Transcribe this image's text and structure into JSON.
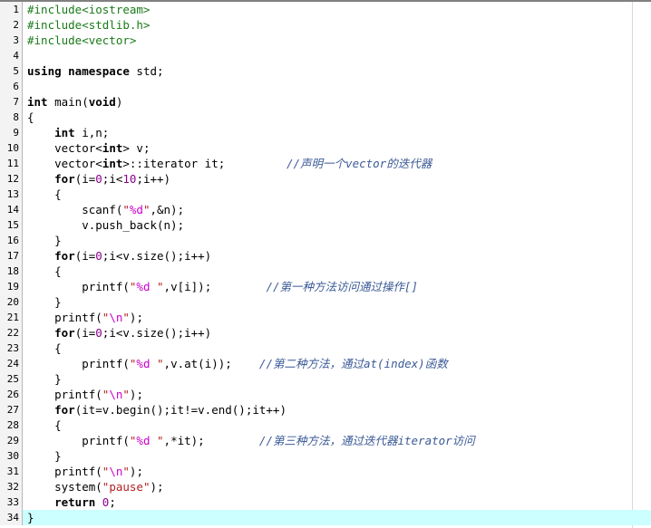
{
  "editor": {
    "name": "cpp-source-code-view",
    "language": "C++",
    "total_lines": 34,
    "highlighted_line": 34,
    "colors": {
      "background": "#ffffff",
      "gutter_background": "#f3f3f3",
      "gutter_separator": "#b8b8b8",
      "highlight_line": "#ccffff",
      "preprocessor": "#1a7a1a",
      "keyword": "#000000",
      "string": "#b22222",
      "escape": "#cc00cc",
      "number": "#8b008b",
      "comment": "#3b5a96",
      "margin_guide": "#d8d8d8"
    }
  },
  "lines": [
    {
      "number": "1",
      "tokens": [
        {
          "t": "#include<iostream>",
          "c": "tok-pre"
        }
      ]
    },
    {
      "number": "2",
      "tokens": [
        {
          "t": "#include<stdlib.h>",
          "c": "tok-pre"
        }
      ]
    },
    {
      "number": "3",
      "tokens": [
        {
          "t": "#include<vector>",
          "c": "tok-pre"
        }
      ]
    },
    {
      "number": "4",
      "tokens": []
    },
    {
      "number": "5",
      "tokens": [
        {
          "t": "using namespace",
          "c": "tok-kw"
        },
        {
          "t": " std;",
          "c": "tok-plain"
        }
      ]
    },
    {
      "number": "6",
      "tokens": []
    },
    {
      "number": "7",
      "tokens": [
        {
          "t": "int",
          "c": "tok-kw"
        },
        {
          "t": " main(",
          "c": "tok-plain"
        },
        {
          "t": "void",
          "c": "tok-kw"
        },
        {
          "t": ")",
          "c": "tok-plain"
        }
      ]
    },
    {
      "number": "8",
      "tokens": [
        {
          "t": "{",
          "c": "tok-plain"
        }
      ]
    },
    {
      "number": "9",
      "tokens": [
        {
          "t": "    ",
          "c": "tok-plain"
        },
        {
          "t": "int",
          "c": "tok-kw"
        },
        {
          "t": " i,n;",
          "c": "tok-plain"
        }
      ]
    },
    {
      "number": "10",
      "tokens": [
        {
          "t": "    vector<",
          "c": "tok-plain"
        },
        {
          "t": "int",
          "c": "tok-kw"
        },
        {
          "t": "> v;",
          "c": "tok-plain"
        }
      ]
    },
    {
      "number": "11",
      "tokens": [
        {
          "t": "    vector<",
          "c": "tok-plain"
        },
        {
          "t": "int",
          "c": "tok-kw"
        },
        {
          "t": ">::iterator it;",
          "c": "tok-plain"
        },
        {
          "t": "         ",
          "c": "tok-plain"
        },
        {
          "t": "//声明一个vector的迭代器",
          "c": "tok-cmt"
        }
      ]
    },
    {
      "number": "12",
      "tokens": [
        {
          "t": "    ",
          "c": "tok-plain"
        },
        {
          "t": "for",
          "c": "tok-kw"
        },
        {
          "t": "(i=",
          "c": "tok-plain"
        },
        {
          "t": "0",
          "c": "tok-num"
        },
        {
          "t": ";i<",
          "c": "tok-plain"
        },
        {
          "t": "10",
          "c": "tok-num"
        },
        {
          "t": ";i++)",
          "c": "tok-plain"
        }
      ]
    },
    {
      "number": "13",
      "tokens": [
        {
          "t": "    {",
          "c": "tok-plain"
        }
      ]
    },
    {
      "number": "14",
      "tokens": [
        {
          "t": "        scanf(",
          "c": "tok-plain"
        },
        {
          "t": "\"",
          "c": "tok-str"
        },
        {
          "t": "%d",
          "c": "tok-esc"
        },
        {
          "t": "\"",
          "c": "tok-str"
        },
        {
          "t": ",&n);",
          "c": "tok-plain"
        }
      ]
    },
    {
      "number": "15",
      "tokens": [
        {
          "t": "        v.push_back(n);",
          "c": "tok-plain"
        }
      ]
    },
    {
      "number": "16",
      "tokens": [
        {
          "t": "    }",
          "c": "tok-plain"
        }
      ]
    },
    {
      "number": "17",
      "tokens": [
        {
          "t": "    ",
          "c": "tok-plain"
        },
        {
          "t": "for",
          "c": "tok-kw"
        },
        {
          "t": "(i=",
          "c": "tok-plain"
        },
        {
          "t": "0",
          "c": "tok-num"
        },
        {
          "t": ";i<v.size();i++)",
          "c": "tok-plain"
        }
      ]
    },
    {
      "number": "18",
      "tokens": [
        {
          "t": "    {",
          "c": "tok-plain"
        }
      ]
    },
    {
      "number": "19",
      "tokens": [
        {
          "t": "        printf(",
          "c": "tok-plain"
        },
        {
          "t": "\"",
          "c": "tok-str"
        },
        {
          "t": "%d",
          "c": "tok-esc"
        },
        {
          "t": " \"",
          "c": "tok-str"
        },
        {
          "t": ",v[i]);",
          "c": "tok-plain"
        },
        {
          "t": "        ",
          "c": "tok-plain"
        },
        {
          "t": "//第一种方法访问通过操作[]",
          "c": "tok-cmt"
        }
      ]
    },
    {
      "number": "20",
      "tokens": [
        {
          "t": "    }",
          "c": "tok-plain"
        }
      ]
    },
    {
      "number": "21",
      "tokens": [
        {
          "t": "    printf(",
          "c": "tok-plain"
        },
        {
          "t": "\"",
          "c": "tok-str"
        },
        {
          "t": "\\n",
          "c": "tok-esc"
        },
        {
          "t": "\"",
          "c": "tok-str"
        },
        {
          "t": ");",
          "c": "tok-plain"
        }
      ]
    },
    {
      "number": "22",
      "tokens": [
        {
          "t": "    ",
          "c": "tok-plain"
        },
        {
          "t": "for",
          "c": "tok-kw"
        },
        {
          "t": "(i=",
          "c": "tok-plain"
        },
        {
          "t": "0",
          "c": "tok-num"
        },
        {
          "t": ";i<v.size();i++)",
          "c": "tok-plain"
        }
      ]
    },
    {
      "number": "23",
      "tokens": [
        {
          "t": "    {",
          "c": "tok-plain"
        }
      ]
    },
    {
      "number": "24",
      "tokens": [
        {
          "t": "        printf(",
          "c": "tok-plain"
        },
        {
          "t": "\"",
          "c": "tok-str"
        },
        {
          "t": "%d",
          "c": "tok-esc"
        },
        {
          "t": " \"",
          "c": "tok-str"
        },
        {
          "t": ",v.at(i));",
          "c": "tok-plain"
        },
        {
          "t": "    ",
          "c": "tok-plain"
        },
        {
          "t": "//第二种方法，通过at(index)函数",
          "c": "tok-cmt"
        }
      ]
    },
    {
      "number": "25",
      "tokens": [
        {
          "t": "    }",
          "c": "tok-plain"
        }
      ]
    },
    {
      "number": "26",
      "tokens": [
        {
          "t": "    printf(",
          "c": "tok-plain"
        },
        {
          "t": "\"",
          "c": "tok-str"
        },
        {
          "t": "\\n",
          "c": "tok-esc"
        },
        {
          "t": "\"",
          "c": "tok-str"
        },
        {
          "t": ");",
          "c": "tok-plain"
        }
      ]
    },
    {
      "number": "27",
      "tokens": [
        {
          "t": "    ",
          "c": "tok-plain"
        },
        {
          "t": "for",
          "c": "tok-kw"
        },
        {
          "t": "(it=v.begin();it!=v.end();it++)",
          "c": "tok-plain"
        }
      ]
    },
    {
      "number": "28",
      "tokens": [
        {
          "t": "    {",
          "c": "tok-plain"
        }
      ]
    },
    {
      "number": "29",
      "tokens": [
        {
          "t": "        printf(",
          "c": "tok-plain"
        },
        {
          "t": "\"",
          "c": "tok-str"
        },
        {
          "t": "%d",
          "c": "tok-esc"
        },
        {
          "t": " \"",
          "c": "tok-str"
        },
        {
          "t": ",*it);",
          "c": "tok-plain"
        },
        {
          "t": "        ",
          "c": "tok-plain"
        },
        {
          "t": "//第三种方法，通过迭代器iterator访问",
          "c": "tok-cmt"
        }
      ]
    },
    {
      "number": "30",
      "tokens": [
        {
          "t": "    }",
          "c": "tok-plain"
        }
      ]
    },
    {
      "number": "31",
      "tokens": [
        {
          "t": "    printf(",
          "c": "tok-plain"
        },
        {
          "t": "\"",
          "c": "tok-str"
        },
        {
          "t": "\\n",
          "c": "tok-esc"
        },
        {
          "t": "\"",
          "c": "tok-str"
        },
        {
          "t": ");",
          "c": "tok-plain"
        }
      ]
    },
    {
      "number": "32",
      "tokens": [
        {
          "t": "    system(",
          "c": "tok-plain"
        },
        {
          "t": "\"pause\"",
          "c": "tok-str"
        },
        {
          "t": ");",
          "c": "tok-plain"
        }
      ]
    },
    {
      "number": "33",
      "tokens": [
        {
          "t": "    ",
          "c": "tok-plain"
        },
        {
          "t": "return",
          "c": "tok-kw"
        },
        {
          "t": " ",
          "c": "tok-plain"
        },
        {
          "t": "0",
          "c": "tok-num"
        },
        {
          "t": ";",
          "c": "tok-plain"
        }
      ]
    },
    {
      "number": "34",
      "highlight": true,
      "tokens": [
        {
          "t": "}",
          "c": "tok-plain"
        }
      ]
    }
  ]
}
